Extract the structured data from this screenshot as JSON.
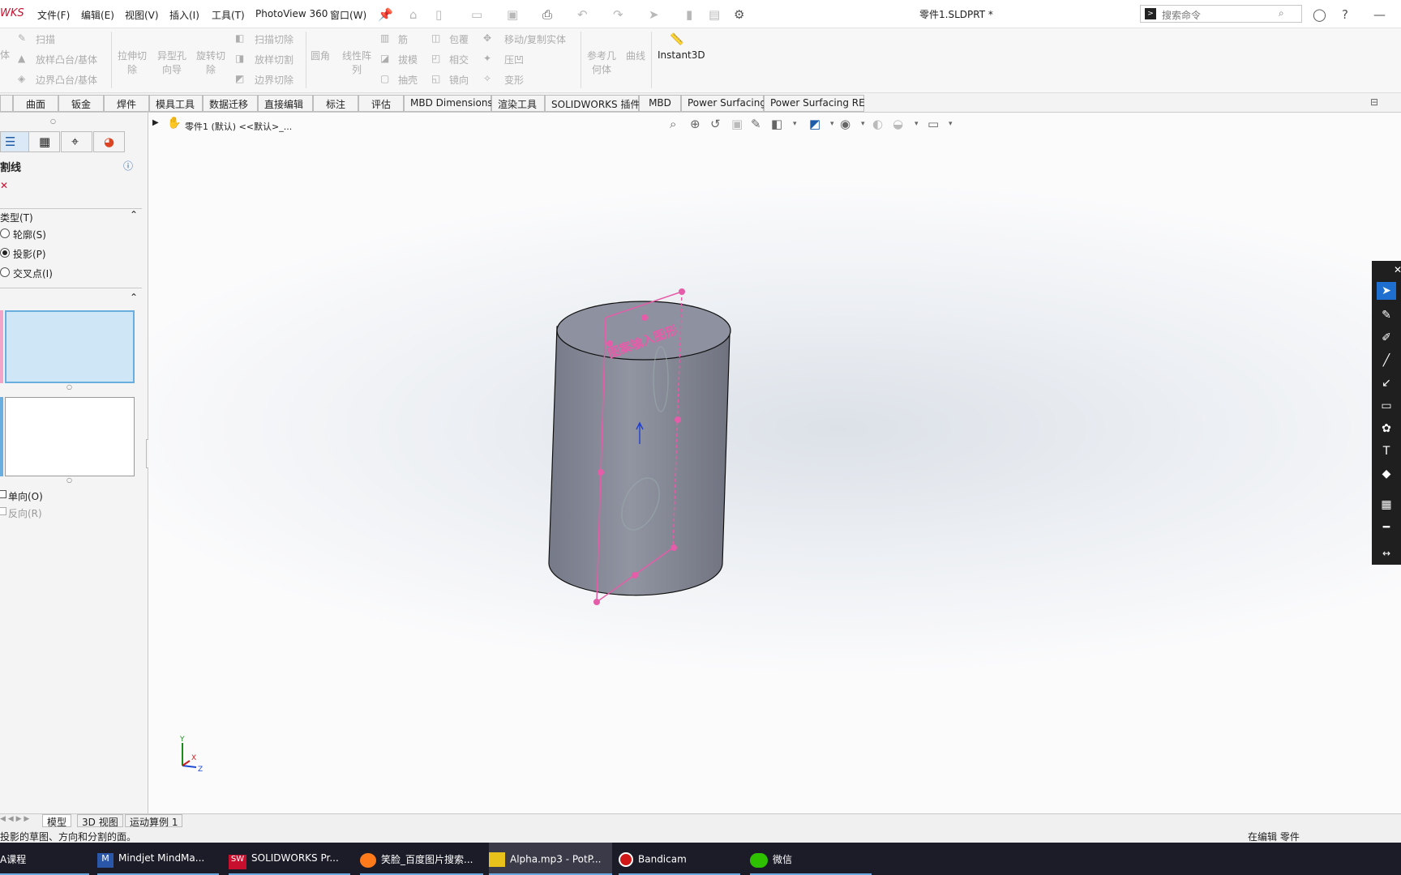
{
  "titlebar": {
    "logo": "WKS",
    "menus": [
      "文件(F)",
      "编辑(E)",
      "视图(V)",
      "插入(I)",
      "工具(T)",
      "PhotoView 360",
      "窗口(W)"
    ],
    "doc_title": "零件1.SLDPRT *",
    "search_placeholder": "搜索命令"
  },
  "ribbon": {
    "col1": [
      "扫描",
      "放样凸台/基体",
      "边界凸台/基体"
    ],
    "col1_left": "体",
    "big_buttons": [
      "拉伸切除",
      "异型孔向导",
      "旋转切除"
    ],
    "col2": [
      "扫描切除",
      "放样切割",
      "边界切除"
    ],
    "big_buttons2": [
      "圆角",
      "线性阵列"
    ],
    "col3": [
      "筋",
      "拔模",
      "抽壳"
    ],
    "col4": [
      "包覆",
      "相交",
      "镜向"
    ],
    "col5": [
      "移动/复制实体",
      "压凹",
      "变形"
    ],
    "big_buttons3": [
      "参考几何体",
      "曲线"
    ],
    "instant3d": "Instant3D"
  },
  "tabs": [
    "曲面",
    "钣金",
    "焊件",
    "模具工具",
    "数据迁移",
    "直接编辑",
    "标注",
    "评估",
    "MBD Dimensions",
    "渲染工具",
    "SOLIDWORKS 插件",
    "MBD",
    "Power Surfacing",
    "Power Surfacing RE"
  ],
  "panel": {
    "title": "割线",
    "section_type": "类型(T)",
    "options": [
      "轮廓(S)",
      "投影(P)",
      "交叉点(I)"
    ],
    "selected_option": "投影(P)",
    "checkbox_single": "单向(O)",
    "checkbox_reverse": "反向(R)"
  },
  "viewport": {
    "breadcrumb": "零件1 (默认) <<默认>_...",
    "sketch_text": "图案输入图形",
    "triad_labels": [
      "Y",
      "X",
      "Z"
    ]
  },
  "bottom_tabs": [
    "模型",
    "3D 视图",
    "运动算例 1"
  ],
  "status": {
    "message": "投影的草图、方向和分割的面。",
    "right": "在编辑 零件"
  },
  "taskbar": {
    "items": [
      "A课程",
      "Mindjet MindMa...",
      "SOLIDWORKS Pr...",
      "笑脸_百度图片搜索...",
      "Alpha.mp3 - PotP...",
      "Bandicam",
      "微信"
    ]
  },
  "colors": {
    "sketch_pink": "#e55ca8",
    "cylinder": "#8b8f9c",
    "taskbar": "#1c1c28",
    "logo_red": "#c8102e"
  }
}
